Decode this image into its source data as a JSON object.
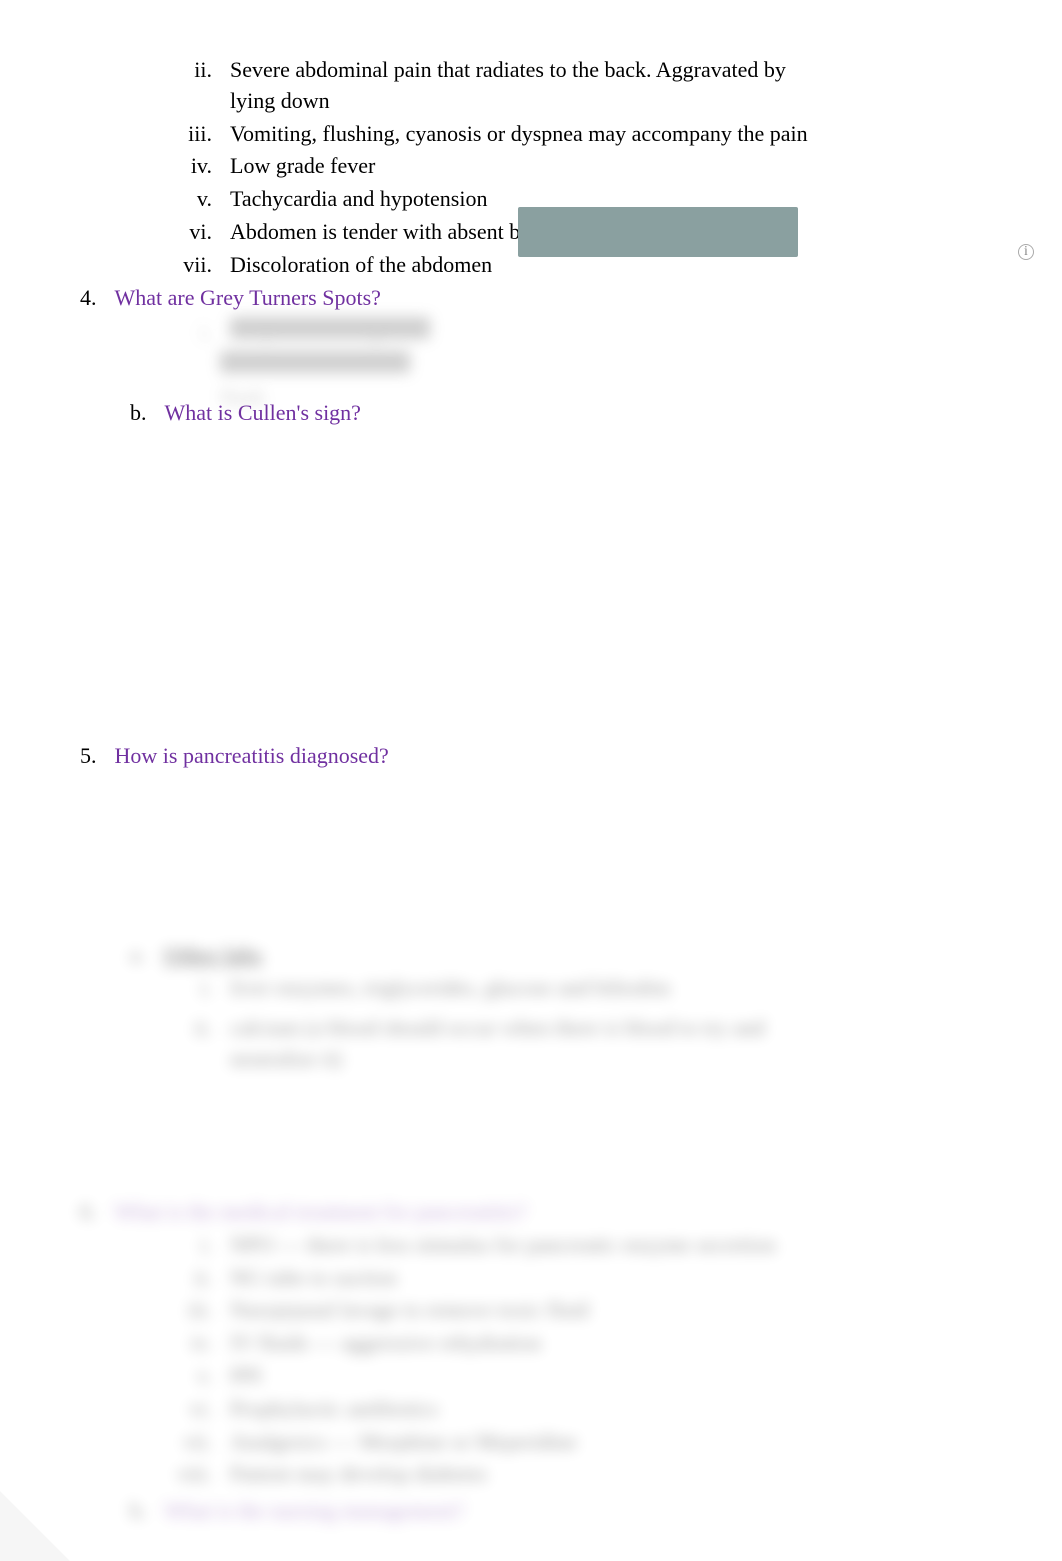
{
  "symptoms": {
    "items": [
      {
        "marker": "ii.",
        "text": "Severe abdominal pain that radiates to the back. Aggravated by lying down"
      },
      {
        "marker": "iii.",
        "text": "Vomiting, flushing, cyanosis or dyspnea may accompany the pain"
      },
      {
        "marker": "iv.",
        "text": "Low grade fever"
      },
      {
        "marker": "v.",
        "text": "Tachycardia and hypotension"
      },
      {
        "marker": "vi.",
        "text": "Abdomen is tender with absent bowel sounds"
      },
      {
        "marker": "vii.",
        "text": "Discoloration of the abdomen"
      }
    ]
  },
  "q4": {
    "marker": "4.",
    "text": "What are Grey Turners Spots?",
    "sub_blur_marker": "i.",
    "sub_blur_text1": "Grey Turner's sign — blue",
    "sub_blur_text2": "discoloration of the flank"
  },
  "q4b": {
    "marker": "b.",
    "text": "What is Cullen's sign?"
  },
  "q5": {
    "marker": "5.",
    "text": "How is pancreatitis diagnosed?"
  },
  "blur_a": {
    "marker": "a.",
    "label": "Other labs",
    "items": [
      {
        "marker": "i.",
        "text": "liver enzymes, triglycerides, glucose and bilirubin"
      },
      {
        "marker": "ii.",
        "text": "calcium (a blood should occur when there is blood to try and neutralize it)"
      }
    ]
  },
  "q6": {
    "marker": "6.",
    "text": "What is the medical treatment for pancreatitis?",
    "items": [
      {
        "marker": "i.",
        "text": "NPO — there is less stimulus for pancreatic enzyme secretion"
      },
      {
        "marker": "ii.",
        "text": "NG tube to suction"
      },
      {
        "marker": "iii.",
        "text": "Nasojejunal lavage to remove toxic fluid"
      },
      {
        "marker": "iv.",
        "text": "IV fluids — aggressive rehydration"
      },
      {
        "marker": "v.",
        "text": "PPI"
      },
      {
        "marker": "vi.",
        "text": "Prophylactic antibiotics"
      },
      {
        "marker": "vii.",
        "text": "Analgesics — Morphine or Meperidine"
      },
      {
        "marker": "viii.",
        "text": "Patient may develop diabetes"
      }
    ]
  },
  "q6b": {
    "marker": "b.",
    "text": "What is the nursing management?"
  },
  "info_tooltip": "i"
}
